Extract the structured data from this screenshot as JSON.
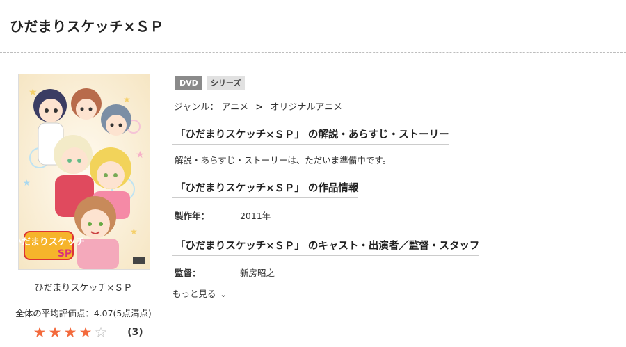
{
  "page": {
    "title": "ひだまりスケッチ×ＳＰ"
  },
  "cover": {
    "caption": "ひだまりスケッチ×ＳＰ",
    "logo_text": "ひだまりスケッチ",
    "logo_sp": "SP",
    "icon": "cover-art-image"
  },
  "rating": {
    "average_label": "全体の平均評価点：4.07(5点満点)",
    "stars": {
      "value": 4.07,
      "max": 5,
      "full": "★",
      "empty": "☆"
    },
    "count": "(3)",
    "colors": {
      "star_full": "#f36a3c",
      "star_empty": "#bbbbbb"
    }
  },
  "badges": [
    "DVD",
    "シリーズ"
  ],
  "genre": {
    "label": "ジャンル：",
    "items": [
      "アニメ",
      "オリジナルアニメ"
    ],
    "separator": ">"
  },
  "sections": {
    "synopsis_heading": "「ひだまりスケッチ×ＳＰ」 の解説・あらすじ・ストーリー",
    "synopsis_text": "解説・あらすじ・ストーリーは、ただいま準備中です。",
    "info_heading": "「ひだまりスケッチ×ＳＰ」 の作品情報",
    "year_label": "製作年：",
    "year_value": "2011年",
    "cast_heading": "「ひだまりスケッチ×ＳＰ」 のキャスト・出演者／監督・スタッフ",
    "director_label": "監督：",
    "director_value": "新房昭之",
    "more_label": "もっと見る",
    "more_icon": "chevron-down-icon"
  }
}
